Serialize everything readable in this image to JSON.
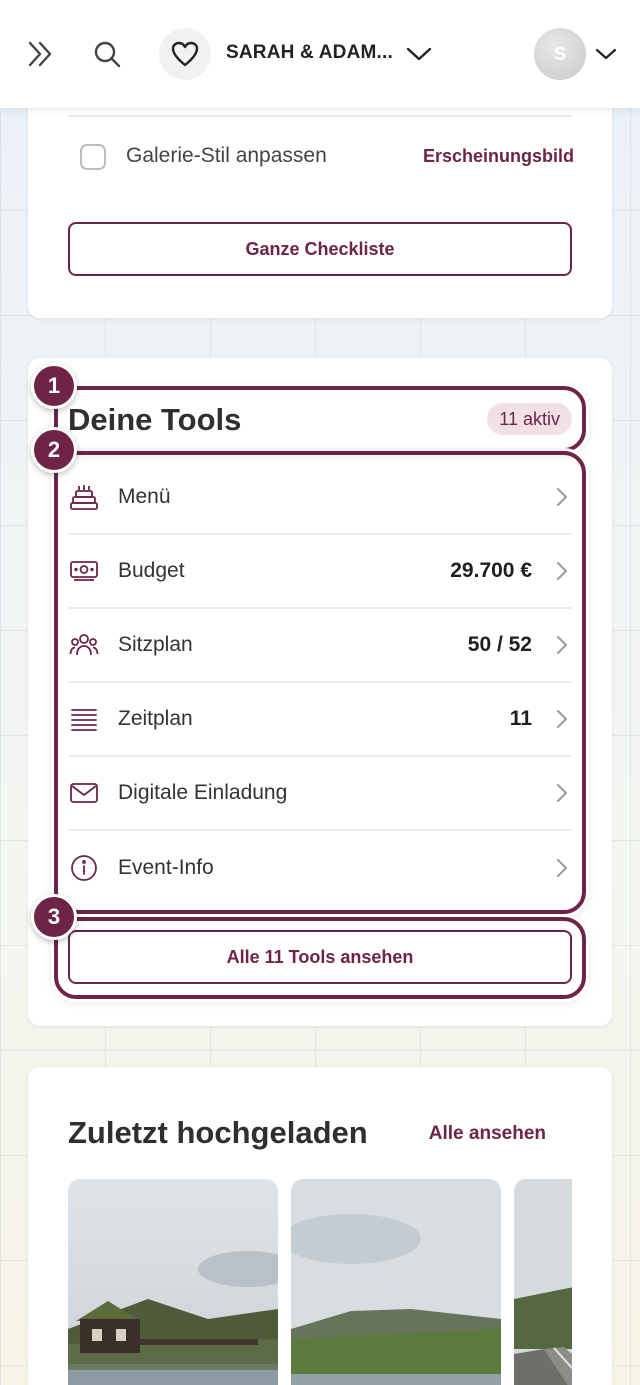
{
  "header": {
    "couple_name": "SARAH & ADAM...",
    "avatar_initial": "S"
  },
  "checklist": {
    "item_label": "Galerie-Stil anpassen",
    "item_category": "Erscheinungsbild",
    "button_label": "Ganze Checkliste"
  },
  "tools": {
    "title": "Deine Tools",
    "active_badge": "11 aktiv",
    "items": [
      {
        "icon": "cake-icon",
        "label": "Menü",
        "value": ""
      },
      {
        "icon": "money-icon",
        "label": "Budget",
        "value": "29.700 €"
      },
      {
        "icon": "people-icon",
        "label": "Sitzplan",
        "value": "50 / 52"
      },
      {
        "icon": "list-lines-icon",
        "label": "Zeitplan",
        "value": "11"
      },
      {
        "icon": "envelope-icon",
        "label": "Digitale Einladung",
        "value": ""
      },
      {
        "icon": "info-icon",
        "label": "Event-Info",
        "value": ""
      }
    ],
    "button_label": "Alle 11 Tools ansehen"
  },
  "highlights": {
    "markers": [
      "1",
      "2",
      "3"
    ]
  },
  "uploads": {
    "title": "Zuletzt hochgeladen",
    "link_label": "Alle ansehen"
  },
  "colors": {
    "accent": "#6d2447",
    "badge_bg": "#f1e1e7"
  }
}
